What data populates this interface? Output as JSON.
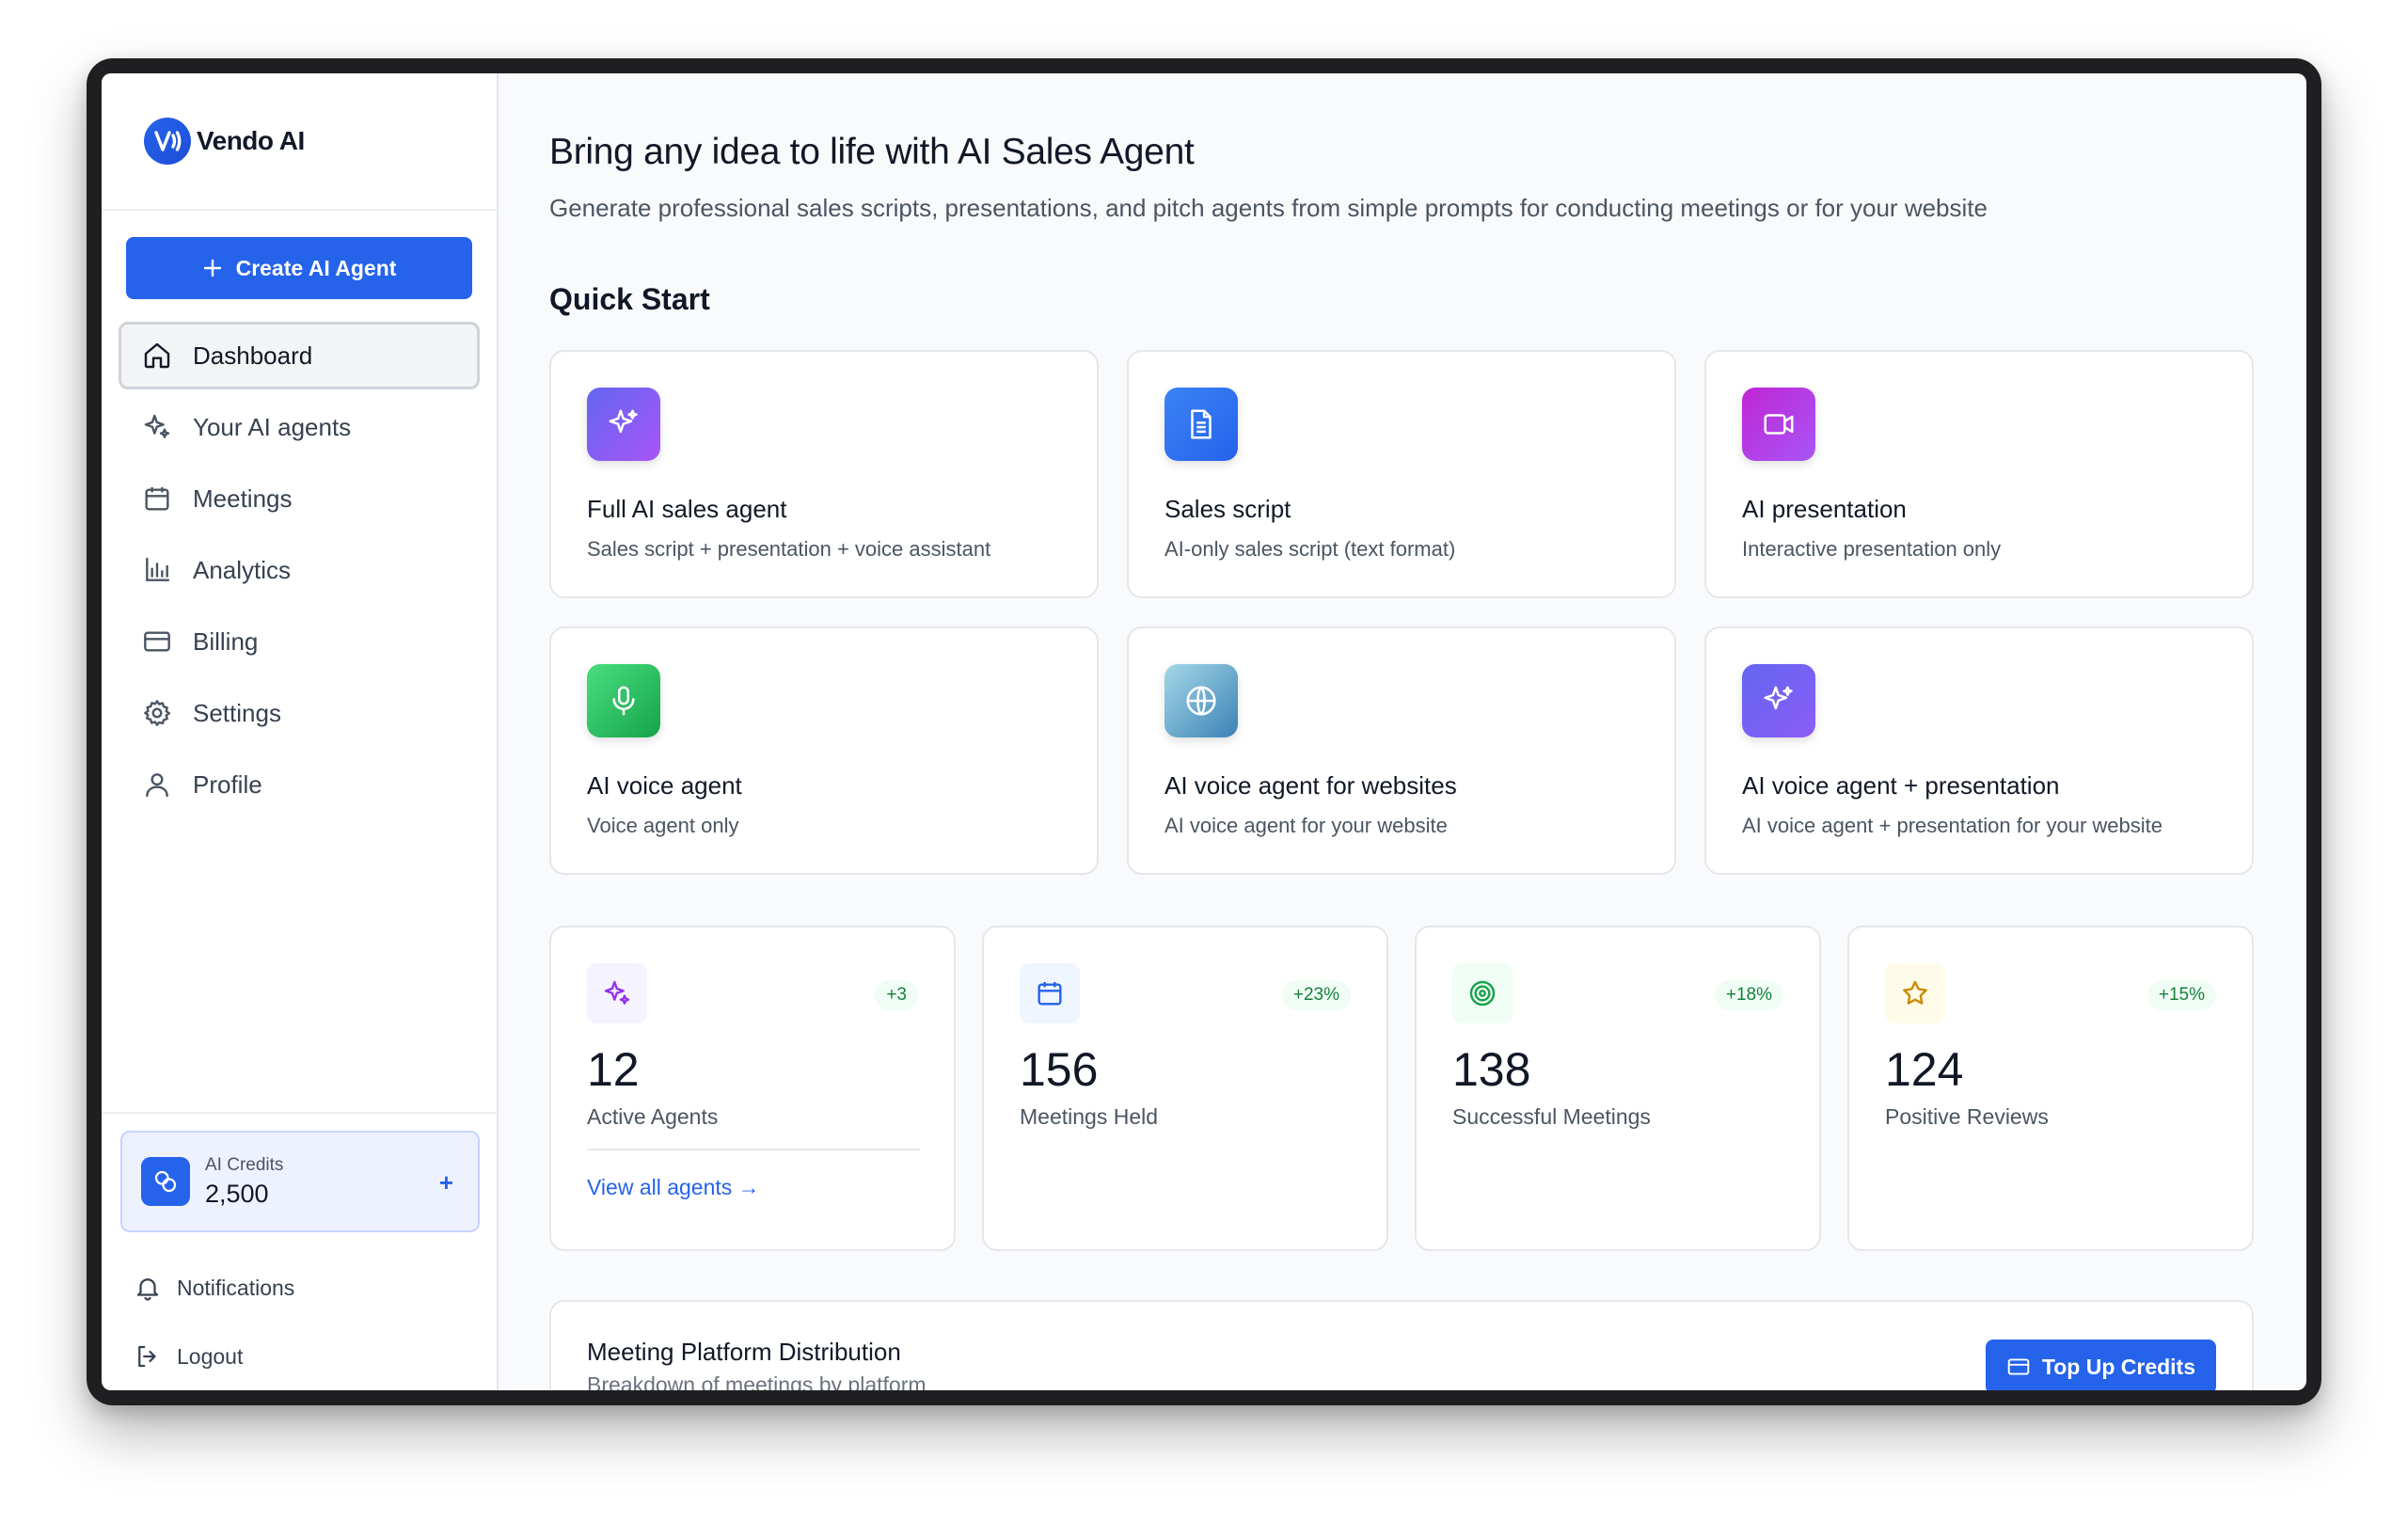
{
  "app": {
    "name": "Vendo AI"
  },
  "sidebar": {
    "create_label": "Create AI Agent",
    "items": [
      {
        "label": "Dashboard",
        "icon": "home-icon",
        "active": true
      },
      {
        "label": "Your AI agents",
        "icon": "sparkles-icon"
      },
      {
        "label": "Meetings",
        "icon": "calendar-icon"
      },
      {
        "label": "Analytics",
        "icon": "bar-chart-icon"
      },
      {
        "label": "Billing",
        "icon": "credit-card-icon"
      },
      {
        "label": "Settings",
        "icon": "gear-icon"
      },
      {
        "label": "Profile",
        "icon": "user-icon"
      }
    ],
    "credits": {
      "label": "AI Credits",
      "value": "2,500",
      "plus": "+"
    },
    "notifications_label": "Notifications",
    "logout_label": "Logout"
  },
  "main": {
    "headline": "Bring any idea to life with AI Sales Agent",
    "subline": "Generate professional sales scripts, presentations, and pitch agents from simple prompts for conducting meetings or for your website",
    "quick_start_title": "Quick Start",
    "quick_start": [
      {
        "title": "Full AI sales agent",
        "desc": "Sales script + presentation + voice assistant",
        "icon": "sparkles-icon",
        "color": "#8b5cf6"
      },
      {
        "title": "Sales script",
        "desc": "AI-only sales script (text format)",
        "icon": "document-icon",
        "color": "#3b82f6"
      },
      {
        "title": "AI presentation",
        "desc": "Interactive presentation only",
        "icon": "video-icon",
        "color": "#a855f7"
      },
      {
        "title": "AI voice agent",
        "desc": "Voice agent only",
        "icon": "microphone-icon",
        "color": "#22c55e"
      },
      {
        "title": "AI voice agent for websites",
        "desc": "AI voice agent for your website",
        "icon": "globe-icon",
        "color": "#5fa8c8"
      },
      {
        "title": "AI voice agent + presentation",
        "desc": "AI voice agent + presentation for your website",
        "icon": "sparkles-icon",
        "color": "#7c3aed"
      }
    ],
    "stats": [
      {
        "value": "12",
        "label": "Active Agents",
        "badge": "+3",
        "icon": "sparkles-icon",
        "link": "View all agents →"
      },
      {
        "value": "156",
        "label": "Meetings Held",
        "badge": "+23%",
        "icon": "calendar-icon"
      },
      {
        "value": "138",
        "label": "Successful Meetings",
        "badge": "+18%",
        "icon": "target-icon"
      },
      {
        "value": "124",
        "label": "Positive Reviews",
        "badge": "+15%",
        "icon": "star-icon"
      }
    ],
    "distribution": {
      "title": "Meeting Platform Distribution",
      "subtitle": "Breakdown of meetings by platform",
      "button_label": "Top Up Credits"
    }
  }
}
